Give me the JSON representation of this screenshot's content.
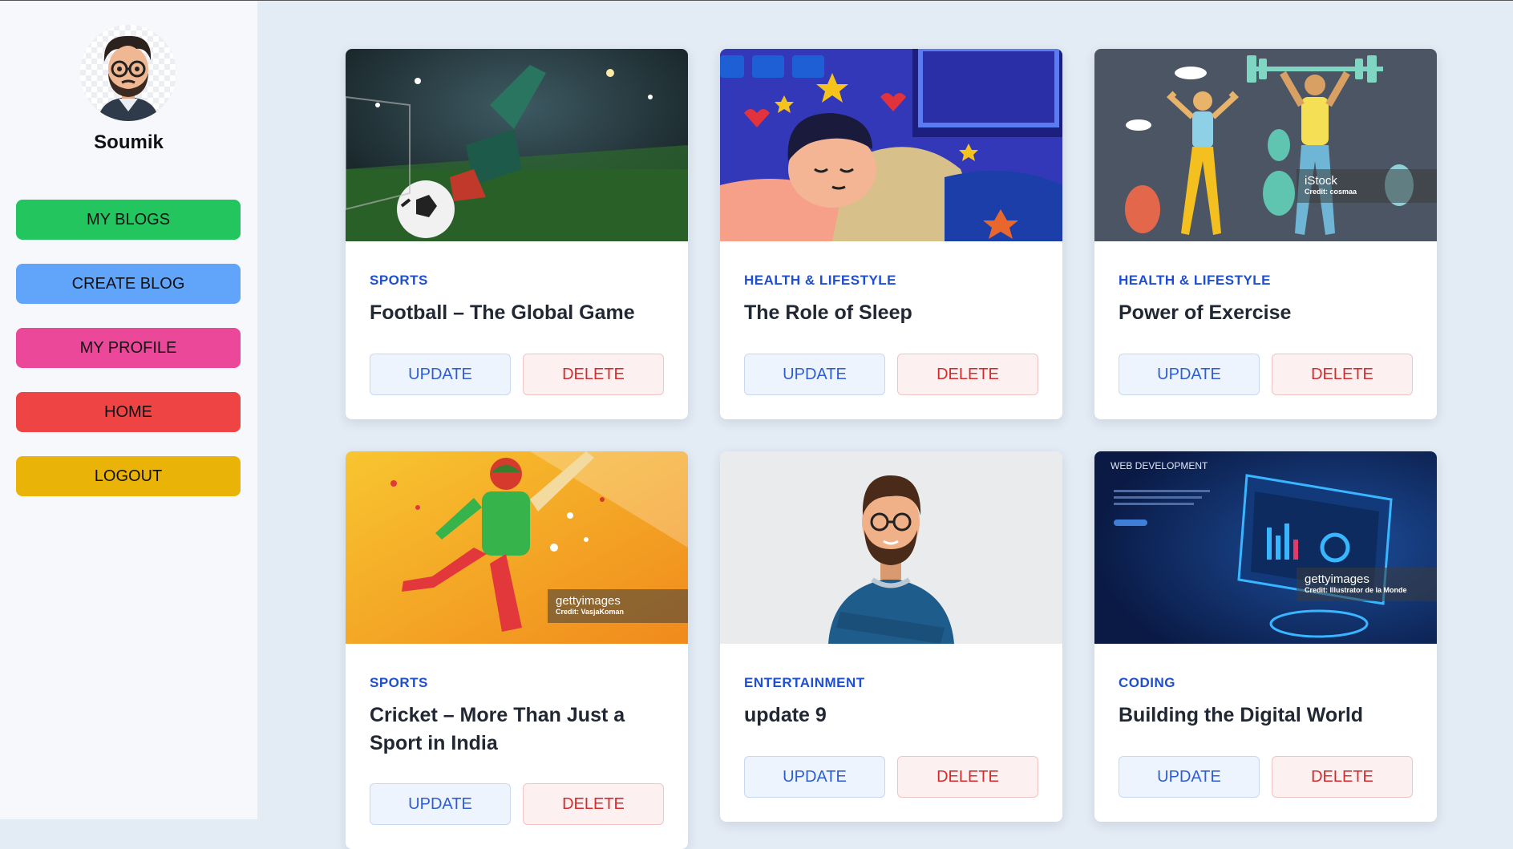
{
  "sidebar": {
    "username": "Soumik",
    "nav": [
      {
        "label": "MY BLOGS",
        "color": "#22c55e"
      },
      {
        "label": "CREATE BLOG",
        "color": "#60a5fa"
      },
      {
        "label": "MY PROFILE",
        "color": "#ec4899"
      },
      {
        "label": "HOME",
        "color": "#ef4444"
      },
      {
        "label": "LOGOUT",
        "color": "#eab308"
      }
    ]
  },
  "blogs": [
    {
      "category": "SPORTS",
      "title": "Football – The Global Game",
      "image": "football-illustration",
      "update_label": "UPDATE",
      "delete_label": "DELETE"
    },
    {
      "category": "HEALTH & LIFESTYLE",
      "title": "The Role of Sleep",
      "image": "sleep-illustration",
      "update_label": "UPDATE",
      "delete_label": "DELETE"
    },
    {
      "category": "HEALTH & LIFESTYLE",
      "title": "Power of Exercise",
      "image": "exercise-illustration",
      "watermark": "iStock",
      "watermark_credit": "Credit: cosmaa",
      "update_label": "UPDATE",
      "delete_label": "DELETE"
    },
    {
      "category": "SPORTS",
      "title": "Cricket – More Than Just a Sport in India",
      "image": "cricket-illustration",
      "watermark": "gettyimages",
      "watermark_credit": "Credit: VasjaKoman",
      "update_label": "UPDATE",
      "delete_label": "DELETE"
    },
    {
      "category": "ENTERTAINMENT",
      "title": "update 9",
      "image": "man-portrait-illustration",
      "update_label": "UPDATE",
      "delete_label": "DELETE"
    },
    {
      "category": "CODING",
      "title": "Building the Digital World",
      "image": "web-development-illustration",
      "image_text": "WEB DEVELOPMENT",
      "watermark": "gettyimages",
      "watermark_credit": "Credit: Illustrator de la Monde",
      "update_label": "UPDATE",
      "delete_label": "DELETE"
    }
  ],
  "colors": {
    "category": "#1f4fd1",
    "update": "#2d5ed4",
    "delete": "#d42c2c",
    "page_bg": "#e3ebf4"
  }
}
